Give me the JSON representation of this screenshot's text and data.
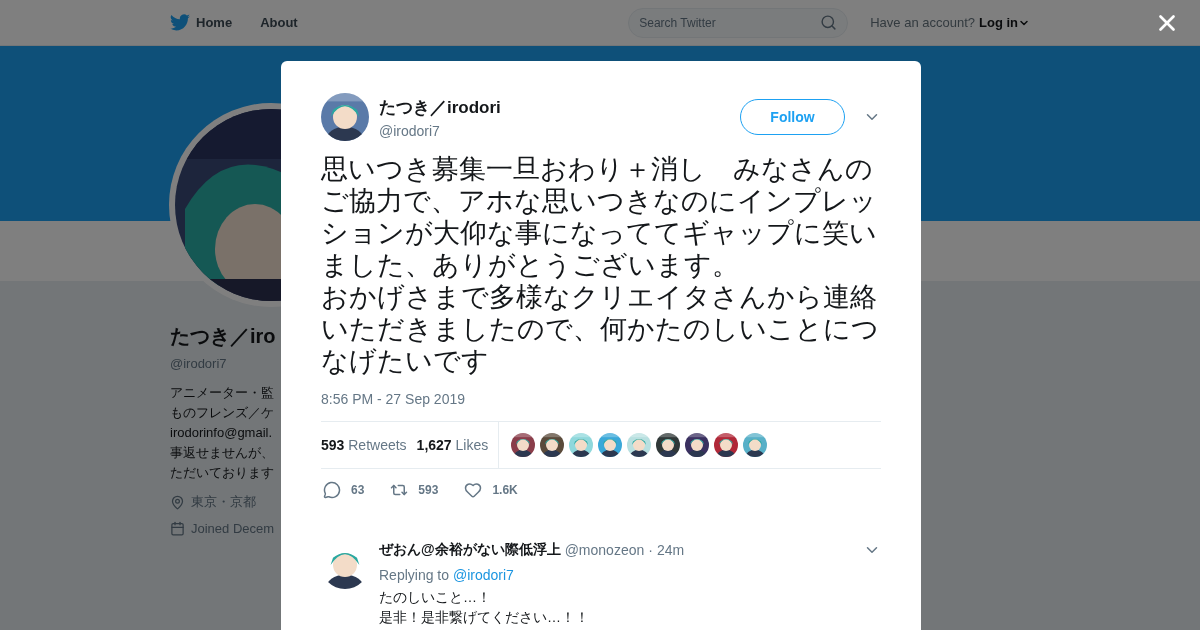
{
  "nav": {
    "items": [
      {
        "label": "Home"
      },
      {
        "label": "About"
      }
    ],
    "search": {
      "placeholder": "Search Twitter"
    },
    "account_prompt": "Have an account?",
    "login": "Log in"
  },
  "profile": {
    "name": "たつき／iro",
    "handle": "@irodori7",
    "bio_lines": [
      "アニメーター・監",
      "ものフレンズ／ケ",
      "irodorinfo@gmail.",
      "事返せませんが、",
      "ただいております"
    ],
    "location": "東京・京都",
    "joined": "Joined Decem"
  },
  "tweet": {
    "author": {
      "name": "たつき／irodori",
      "handle": "@irodori7"
    },
    "follow": "Follow",
    "paragraphs": [
      "思いつき募集一旦おわり＋消し　みなさんのご協力で、アホな思いつきなのにインプレッションが大仰な事になっててギャップに笑いました、ありがとうございます。",
      "おかげさまで多様なクリエイタさんから連絡いただきましたので、何かたのしいことにつなげたいです"
    ],
    "timestamp": "8:56 PM - 27 Sep 2019",
    "stats": [
      {
        "count": "593",
        "label": "Retweets"
      },
      {
        "count": "1,627",
        "label": "Likes"
      }
    ],
    "likers": [
      {
        "color": "#8a3d4a"
      },
      {
        "color": "#5a4a3a"
      },
      {
        "color": "#8fd8dc"
      },
      {
        "color": "#3aa8d8"
      },
      {
        "color": "#b8e0e0"
      },
      {
        "color": "#303838"
      },
      {
        "color": "#3a3060"
      },
      {
        "color": "#b02838"
      },
      {
        "color": "#58b0c8"
      }
    ],
    "actions": [
      {
        "kind": "reply",
        "count": "63"
      },
      {
        "kind": "retweet",
        "count": "593"
      },
      {
        "kind": "like",
        "count": "1.6K"
      }
    ]
  },
  "reply": {
    "name": "ぜおん@余裕がない際低浮上",
    "handle": "@monozeon",
    "time_separator": "·",
    "time": "24m",
    "replying_to": "Replying to",
    "mention": "@irodori7",
    "lines": [
      "たのしいこと…！",
      "是非！是非繋げてください…！！"
    ]
  }
}
